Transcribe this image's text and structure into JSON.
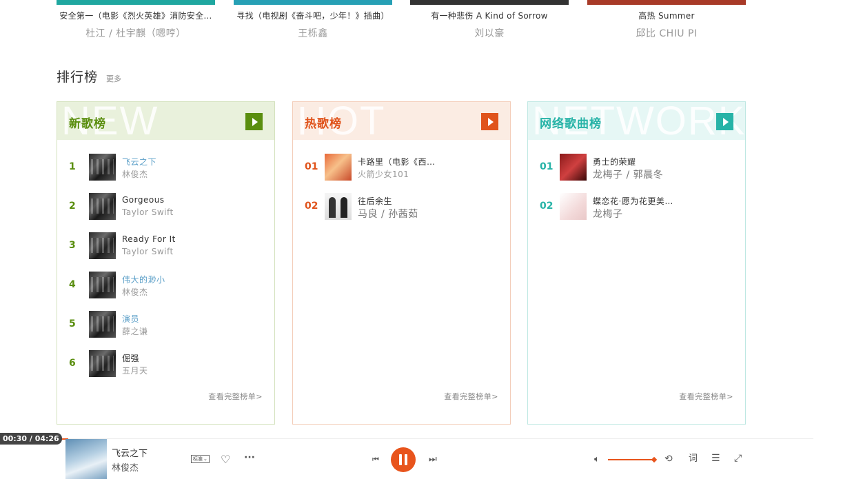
{
  "top_tiles": [
    {
      "title": "安全第一（电影《烈火英雄》消防安全…",
      "artist": "杜江 / 杜宇麒（嗯哼）",
      "color": "#1fa7a0"
    },
    {
      "title": "寻找（电视剧《奋斗吧，少年！》插曲）",
      "artist": "王栎鑫",
      "color": "#27a0b5"
    },
    {
      "title": "有一种悲伤 A Kind of Sorrow",
      "artist": "刘以豪",
      "color": "#333333"
    },
    {
      "title": "高热 Summer",
      "artist": "邱比 CHIU PI",
      "color": "#a83a28"
    }
  ],
  "section": {
    "title": "排行榜",
    "more": "更多"
  },
  "cards": [
    {
      "title": "新歌榜",
      "watermark": "NEW",
      "accent": "#5a8e0f",
      "head_bg": "#e9f1dc",
      "border": "#d3e2bd",
      "footer": "查看完整榜单>",
      "items": [
        {
          "rank": "1",
          "song": "飞云之下",
          "artist": "林俊杰",
          "link": true,
          "cover": "dark"
        },
        {
          "rank": "2",
          "song": "Gorgeous",
          "artist": "Taylor Swift",
          "link": false,
          "cover": "dark"
        },
        {
          "rank": "3",
          "song": "Ready For It",
          "artist": "Taylor Swift",
          "link": false,
          "cover": "dark"
        },
        {
          "rank": "4",
          "song": "伟大的渺小",
          "artist": "林俊杰",
          "link": true,
          "cover": "dark"
        },
        {
          "rank": "5",
          "song": "演员",
          "artist": "薛之谦",
          "link": true,
          "cover": "dark"
        },
        {
          "rank": "6",
          "song": "倔强",
          "artist": "五月天",
          "link": false,
          "cover": "dark"
        }
      ]
    },
    {
      "title": "热歌榜",
      "watermark": "HOT",
      "accent": "#e0531b",
      "head_bg": "#fbece3",
      "border": "#f3cdb9",
      "footer": "查看完整榜单>",
      "items": [
        {
          "rank": "01",
          "song": "卡路里（电影《西…",
          "artist": "火箭少女101",
          "link": false,
          "cover": "orange"
        },
        {
          "rank": "02",
          "song": "往后余生",
          "artist": "马良 / 孙茜茹",
          "link": false,
          "cover": "white",
          "big": true
        }
      ]
    },
    {
      "title": "网络歌曲榜",
      "watermark": "NETWORK",
      "accent": "#27b3a7",
      "head_bg": "#e6f7f5",
      "border": "#bfe8e3",
      "footer": "查看完整榜单>",
      "items": [
        {
          "rank": "01",
          "song": "勇士的荣耀",
          "artist": "龙梅子 / 郭晨冬",
          "link": false,
          "cover": "red",
          "big": true
        },
        {
          "rank": "02",
          "song": "蝶恋花·愿为花更美…",
          "artist": "龙梅子",
          "link": false,
          "cover": "pink",
          "big": true
        }
      ]
    }
  ],
  "player": {
    "time": "00:30 / 04:26",
    "progress": 0.113,
    "title": "飞云之下",
    "artist": "林俊杰",
    "quality": "标准",
    "lyrics_label": "词",
    "volume": 1.0,
    "icons": [
      "heart-icon",
      "more-icon",
      "prev-icon",
      "pause-icon",
      "next-icon",
      "volume-icon",
      "loop-icon",
      "lyrics-icon",
      "playlist-icon",
      "fullscreen-icon"
    ]
  }
}
